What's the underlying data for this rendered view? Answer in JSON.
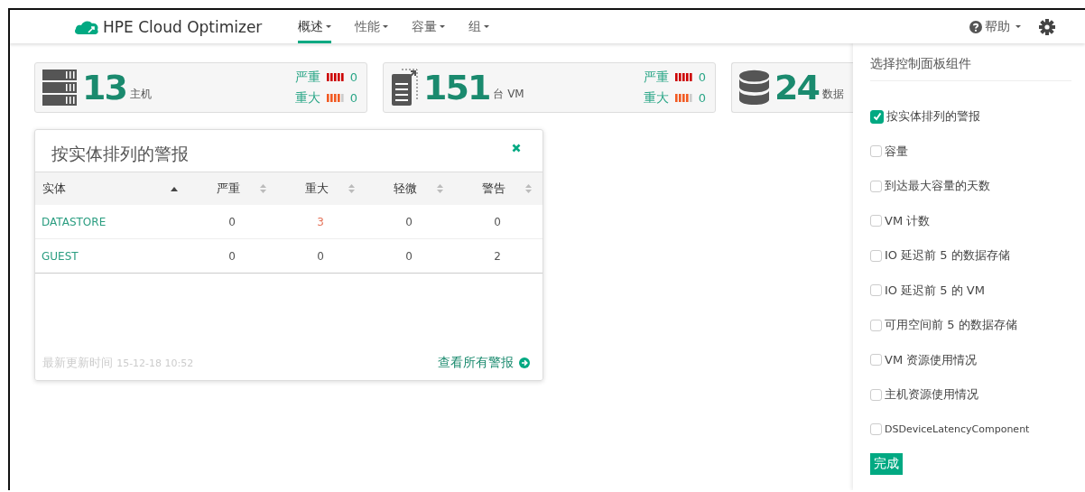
{
  "brand": "HPE Cloud Optimizer",
  "nav": [
    {
      "label": "概述",
      "selected": true
    },
    {
      "label": "性能",
      "selected": false
    },
    {
      "label": "容量",
      "selected": false
    },
    {
      "label": "组",
      "selected": false
    }
  ],
  "help": "帮助",
  "stats": [
    {
      "kind": "host",
      "value": "13",
      "unit": "主机",
      "alerts": [
        {
          "kind": "critical",
          "label": "严重",
          "count": "0"
        },
        {
          "kind": "major",
          "label": "重大",
          "count": "0"
        }
      ]
    },
    {
      "kind": "vm",
      "value": "151",
      "unit": "台 VM",
      "alerts": [
        {
          "kind": "critical",
          "label": "严重",
          "count": "0"
        },
        {
          "kind": "major",
          "label": "重大",
          "count": "0"
        }
      ]
    },
    {
      "kind": "datastore",
      "value": "24",
      "unit": "数据"
    }
  ],
  "widget": {
    "title": "按实体排列的警报",
    "columns": [
      {
        "label": "实体",
        "sorted": true
      },
      {
        "label": "严重",
        "sorted": false
      },
      {
        "label": "重大",
        "sorted": false
      },
      {
        "label": "轻微",
        "sorted": false
      },
      {
        "label": "警告",
        "sorted": false
      }
    ],
    "rows": [
      {
        "cells": [
          {
            "text": "DATASTORE",
            "alert": false
          },
          {
            "text": "0",
            "alert": false
          },
          {
            "text": "3",
            "alert": true
          },
          {
            "text": "0",
            "alert": false
          },
          {
            "text": "0",
            "alert": false
          }
        ]
      },
      {
        "cells": [
          {
            "text": "GUEST",
            "alert": false
          },
          {
            "text": "0",
            "alert": false
          },
          {
            "text": "0",
            "alert": false
          },
          {
            "text": "0",
            "alert": false
          },
          {
            "text": "2",
            "alert": false
          }
        ]
      }
    ],
    "updated_label": "最新更新时间",
    "updated_time": "15-12-18 10:52",
    "view_all": "查看所有警报"
  },
  "panel": {
    "title": "选择控制面板组件",
    "items": [
      {
        "label": "按实体排列的警报",
        "checked": true
      },
      {
        "label": "容量",
        "checked": false
      },
      {
        "label": "到达最大容量的天数",
        "checked": false
      },
      {
        "label": "VM 计数",
        "checked": false
      },
      {
        "label": "IO 延迟前 5 的数据存储",
        "checked": false
      },
      {
        "label": "IO 延迟前 5 的 VM",
        "checked": false
      },
      {
        "label": "可用空间前 5 的数据存储",
        "checked": false
      },
      {
        "label": "VM 资源使用情况",
        "checked": false
      },
      {
        "label": "主机资源使用情况",
        "checked": false
      },
      {
        "label": "DSDeviceLatencyComponent",
        "checked": false
      }
    ],
    "done": "完成"
  }
}
